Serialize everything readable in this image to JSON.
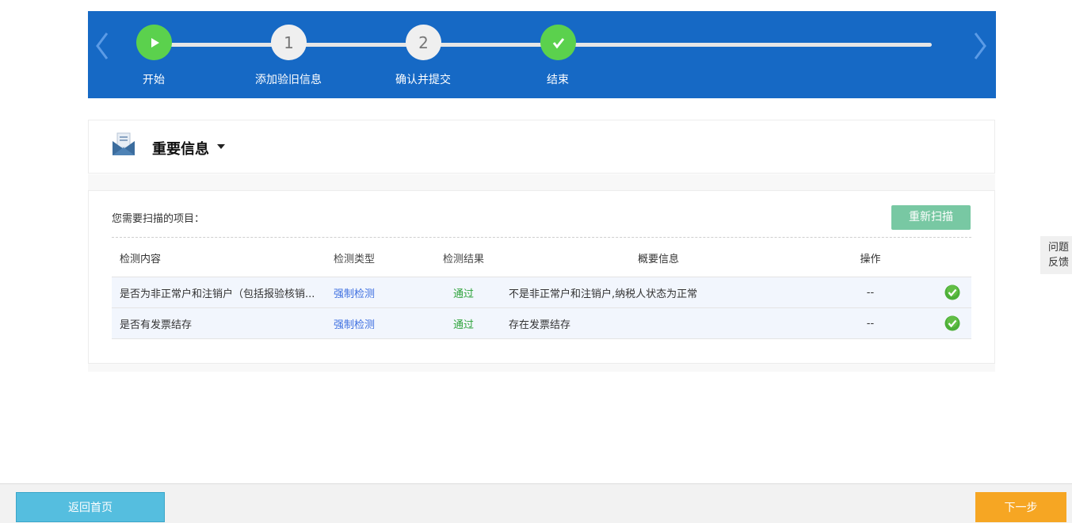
{
  "stepper": {
    "steps": [
      {
        "label": "开始",
        "marker": "",
        "state": "done",
        "icon": "play-icon"
      },
      {
        "label": "添加验旧信息",
        "marker": "1",
        "state": "todo"
      },
      {
        "label": "确认并提交",
        "marker": "2",
        "state": "todo"
      },
      {
        "label": "结束",
        "marker": "",
        "state": "done",
        "icon": "check-icon"
      }
    ],
    "colors": {
      "banner": "#1669c5",
      "done": "#5bd14d",
      "todo": "#efefef"
    }
  },
  "info": {
    "title": "重要信息",
    "icon": "envelope-icon"
  },
  "scan": {
    "label": "您需要扫描的项目：",
    "rescan_label": "重新扫描",
    "columns": {
      "content": "检测内容",
      "type": "检测类型",
      "result": "检测结果",
      "summary": "概要信息",
      "op": "操作"
    },
    "rows": [
      {
        "content": "是否为非正常户和注销户（包括报验核销...",
        "type": "强制检测",
        "result": "通过",
        "summary": "不是非正常户和注销户,纳税人状态为正常",
        "op": "--",
        "status_icon": "check-circle-icon"
      },
      {
        "content": "是否有发票结存",
        "type": "强制检测",
        "result": "通过",
        "summary": "存在发票结存",
        "op": "--",
        "status_icon": "check-circle-icon"
      }
    ]
  },
  "feedback": {
    "line1": "问题",
    "line2": "反馈"
  },
  "footer": {
    "home_label": "返回首页",
    "next_label": "下一步"
  }
}
